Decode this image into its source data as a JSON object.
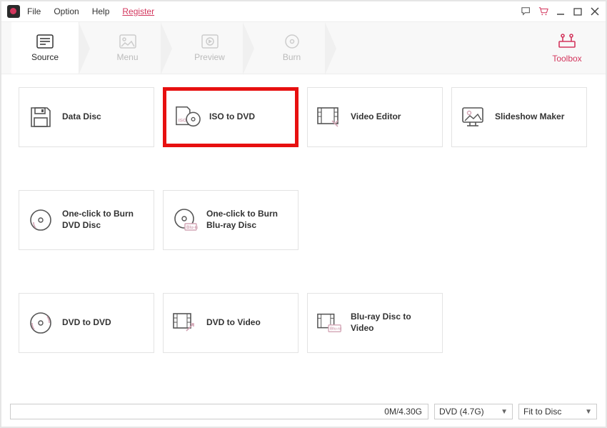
{
  "menu": {
    "file": "File",
    "option": "Option",
    "help": "Help",
    "register": "Register"
  },
  "steps": [
    {
      "label": "Source",
      "active": true
    },
    {
      "label": "Menu",
      "active": false
    },
    {
      "label": "Preview",
      "active": false
    },
    {
      "label": "Burn",
      "active": false
    }
  ],
  "toolbox_label": "Toolbox",
  "cards": {
    "data_disc": "Data Disc",
    "iso_to_dvd": "ISO to DVD",
    "video_editor": "Video Editor",
    "slideshow_maker": "Slideshow Maker",
    "oneclick_dvd": "One-click to Burn DVD Disc",
    "oneclick_bluray": "One-click to Burn Blu-ray Disc",
    "dvd_to_dvd": "DVD to DVD",
    "dvd_to_video": "DVD to Video",
    "bluray_to_video": "Blu-ray Disc to Video"
  },
  "bottom": {
    "progress": "0M/4.30G",
    "disc_type": "DVD (4.7G)",
    "fit": "Fit to Disc"
  }
}
